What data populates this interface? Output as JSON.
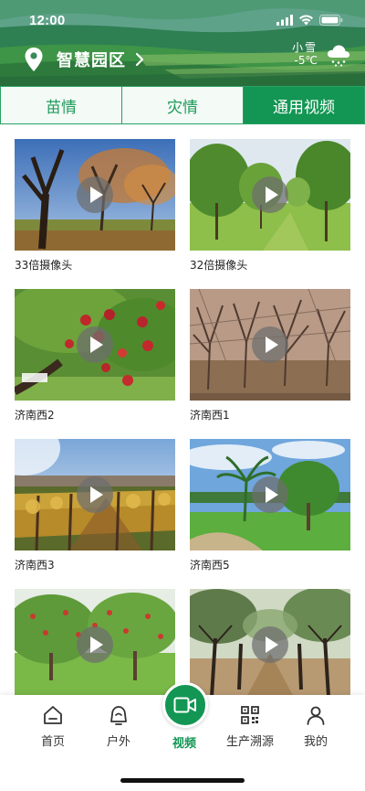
{
  "status_bar": {
    "time": "12:00"
  },
  "header": {
    "location_label": "智慧园区",
    "weather_condition": "小雪",
    "weather_temp": "-5℃"
  },
  "tabs": [
    {
      "label": "苗情",
      "active": false
    },
    {
      "label": "灾情",
      "active": false
    },
    {
      "label": "通用视频",
      "active": true
    }
  ],
  "videos": [
    {
      "title": "33倍摄像头",
      "scene": "orchard-sunset"
    },
    {
      "title": "32倍摄像头",
      "scene": "orchard-green-rows"
    },
    {
      "title": "济南西2",
      "scene": "apple-tree-closeup"
    },
    {
      "title": "济南西1",
      "scene": "bare-winter-orchard"
    },
    {
      "title": "济南西3",
      "scene": "vineyard-autumn"
    },
    {
      "title": "济南西5",
      "scene": "palm-mango-garden"
    },
    {
      "title": "",
      "scene": "apple-orchard-red"
    },
    {
      "title": "",
      "scene": "pear-orchard-blossom"
    }
  ],
  "bottom_nav": [
    {
      "label": "首页",
      "icon": "home-icon",
      "active": false
    },
    {
      "label": "户外",
      "icon": "outdoor-icon",
      "active": false
    },
    {
      "label": "视频",
      "icon": "video-camera-icon",
      "active": true
    },
    {
      "label": "生产溯源",
      "icon": "qr-code-icon",
      "active": false
    },
    {
      "label": "我的",
      "icon": "user-icon",
      "active": false
    }
  ],
  "colors": {
    "accent": "#139653",
    "tab_border": "#2aa065"
  }
}
